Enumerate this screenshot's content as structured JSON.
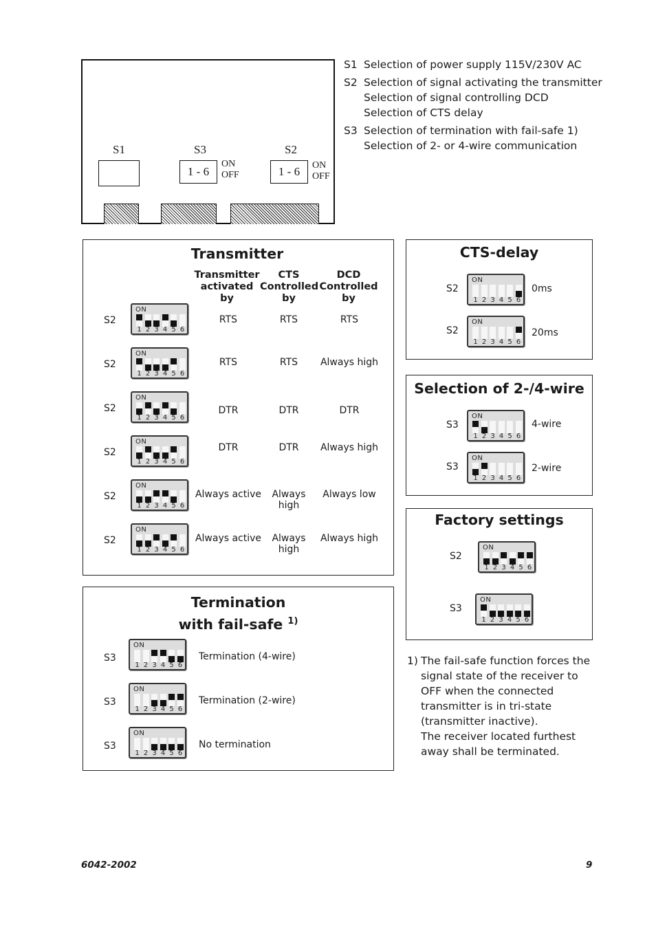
{
  "board": {
    "labels": {
      "s1": "S1",
      "s3": "S3",
      "s2": "S2"
    },
    "s3_range": "1 - 6",
    "s2_range": "1 - 6",
    "on": "ON",
    "off": "OFF"
  },
  "legend": [
    {
      "key": "S1",
      "lines": [
        "Selection of power supply 115V/230V AC"
      ]
    },
    {
      "key": "S2",
      "lines": [
        "Selection of signal activating the transmitter",
        "Selection of signal controlling DCD",
        "Selection of CTS delay"
      ]
    },
    {
      "key": "S3",
      "lines": [
        "Selection of termination with fail-safe 1)",
        "Selection of 2- or 4-wire communication"
      ]
    }
  ],
  "dip_on_label": "ON",
  "dip_numbers": [
    "1",
    "2",
    "3",
    "4",
    "5",
    "6"
  ],
  "transmitter": {
    "title": "Transmitter",
    "headers": [
      [
        "Transmitter",
        "activated",
        "by"
      ],
      [
        "CTS",
        "Controlled",
        "by"
      ],
      [
        "DCD",
        "Controlled",
        "by"
      ]
    ],
    "rows": [
      {
        "switch": "S2",
        "states": [
          "up",
          "down",
          "down",
          "up",
          "down",
          "none"
        ],
        "cells": [
          "RTS",
          "RTS",
          "RTS"
        ]
      },
      {
        "switch": "S2",
        "states": [
          "up",
          "down",
          "down",
          "down",
          "up",
          "none"
        ],
        "cells": [
          "RTS",
          "RTS",
          "Always high"
        ]
      },
      {
        "switch": "S2",
        "states": [
          "down",
          "up",
          "down",
          "up",
          "down",
          "none"
        ],
        "cells": [
          "DTR",
          "DTR",
          "DTR"
        ]
      },
      {
        "switch": "S2",
        "states": [
          "down",
          "up",
          "down",
          "down",
          "up",
          "none"
        ],
        "cells": [
          "DTR",
          "DTR",
          "Always high"
        ]
      },
      {
        "switch": "S2",
        "states": [
          "down",
          "down",
          "up",
          "up",
          "down",
          "none"
        ],
        "cells": [
          "Always active",
          "Always high",
          "Always low"
        ]
      },
      {
        "switch": "S2",
        "states": [
          "down",
          "down",
          "up",
          "down",
          "up",
          "none"
        ],
        "cells": [
          "Always active",
          "Always high",
          "Always high"
        ]
      }
    ]
  },
  "cts_delay": {
    "title": "CTS-delay",
    "rows": [
      {
        "switch": "S2",
        "states": [
          "none",
          "none",
          "none",
          "none",
          "none",
          "down"
        ],
        "label": "0ms"
      },
      {
        "switch": "S2",
        "states": [
          "none",
          "none",
          "none",
          "none",
          "none",
          "up"
        ],
        "label": "20ms"
      }
    ]
  },
  "wire": {
    "title": "Selection of 2-/4-wire",
    "rows": [
      {
        "switch": "S3",
        "states": [
          "up",
          "down",
          "none",
          "none",
          "none",
          "none"
        ],
        "label": "4-wire"
      },
      {
        "switch": "S3",
        "states": [
          "down",
          "up",
          "none",
          "none",
          "none",
          "none"
        ],
        "label": "2-wire"
      }
    ]
  },
  "factory": {
    "title": "Factory settings",
    "rows": [
      {
        "switch": "S2",
        "states": [
          "down",
          "down",
          "up",
          "down",
          "up",
          "up"
        ]
      },
      {
        "switch": "S3",
        "states": [
          "up",
          "down",
          "down",
          "down",
          "down",
          "down"
        ]
      }
    ]
  },
  "termination": {
    "title_line1": "Termination",
    "title_line2": "with fail-safe",
    "title_sup": "1)",
    "rows": [
      {
        "switch": "S3",
        "states": [
          "none",
          "none",
          "up",
          "up",
          "down",
          "down"
        ],
        "label": "Termination (4-wire)"
      },
      {
        "switch": "S3",
        "states": [
          "none",
          "none",
          "down",
          "down",
          "up",
          "up"
        ],
        "label": "Termination (2-wire)"
      },
      {
        "switch": "S3",
        "states": [
          "none",
          "none",
          "down",
          "down",
          "down",
          "down"
        ],
        "label": "No termination"
      }
    ]
  },
  "footnote": {
    "marker": "1)",
    "lines": [
      "The fail-safe function forces the",
      "signal state of the receiver to",
      "OFF when the connected",
      "transmitter is in tri-state",
      "(transmitter inactive).",
      "The receiver located furthest",
      "away shall be terminated."
    ]
  },
  "footer": {
    "doc_number": "6042-2002",
    "page_number": "9"
  }
}
